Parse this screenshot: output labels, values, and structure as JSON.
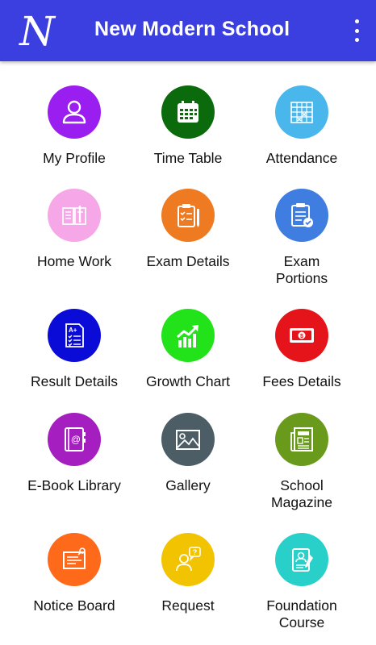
{
  "app": {
    "title": "New Modern School",
    "logo_letter": "N"
  },
  "header": {
    "menu_icon": "more-vert-icon"
  },
  "tiles": [
    {
      "label": "My Profile",
      "icon": "user-icon",
      "color": "#9b1ef0"
    },
    {
      "label": "Time Table",
      "icon": "calendar-icon",
      "color": "#0b6a0b"
    },
    {
      "label": "Attendance",
      "icon": "attendance-grid-icon",
      "color": "#49b6ec"
    },
    {
      "label": "Home Work",
      "icon": "notebook-icon",
      "color": "#f6a7e8"
    },
    {
      "label": "Exam Details",
      "icon": "clipboard-pencil-icon",
      "color": "#ee7a22"
    },
    {
      "label": "Exam\nPortions",
      "icon": "checklist-icon",
      "color": "#3f7de0"
    },
    {
      "label": "Result Details",
      "icon": "report-card-icon",
      "color": "#0b0bd8"
    },
    {
      "label": "Growth Chart",
      "icon": "growth-chart-icon",
      "color": "#22e21a"
    },
    {
      "label": "Fees Details",
      "icon": "money-icon",
      "color": "#e5141a"
    },
    {
      "label": "E-Book Library",
      "icon": "address-book-icon",
      "color": "#a51fc0"
    },
    {
      "label": "Gallery",
      "icon": "image-icon",
      "color": "#4c5d66"
    },
    {
      "label": "School\nMagazine",
      "icon": "newspaper-icon",
      "color": "#6a9a1c"
    },
    {
      "label": "Notice Board",
      "icon": "notice-board-icon",
      "color": "#ff6a1a"
    },
    {
      "label": "Request",
      "icon": "question-person-icon",
      "color": "#f2c300"
    },
    {
      "label": "Foundation\nCourse",
      "icon": "certificate-icon",
      "color": "#29d0c9"
    }
  ]
}
